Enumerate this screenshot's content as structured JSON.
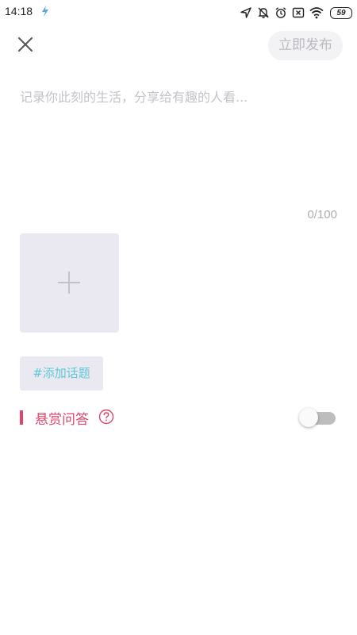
{
  "status_bar": {
    "time": "14:18",
    "battery": "59",
    "icons": [
      "location-icon",
      "mute-icon",
      "alarm-icon",
      "sim-icon",
      "wifi-icon",
      "battery-icon"
    ]
  },
  "header": {
    "close_icon": "close-icon",
    "publish_label": "立即发布"
  },
  "editor": {
    "placeholder": "记录你此刻的生活，分享给有趣的人看...",
    "value": "",
    "char_count": "0/100"
  },
  "add_image": {
    "icon": "plus-icon"
  },
  "topic": {
    "label": "#添加话题"
  },
  "reward": {
    "label": "悬赏问答",
    "help_icon": "question-icon",
    "enabled": false
  },
  "colors": {
    "accent": "#e0446a",
    "topic": "#5ec8d7",
    "tile_bg": "#eae9f1",
    "publish_bg": "#f3f3f5",
    "publish_text": "#b9b9bf"
  }
}
